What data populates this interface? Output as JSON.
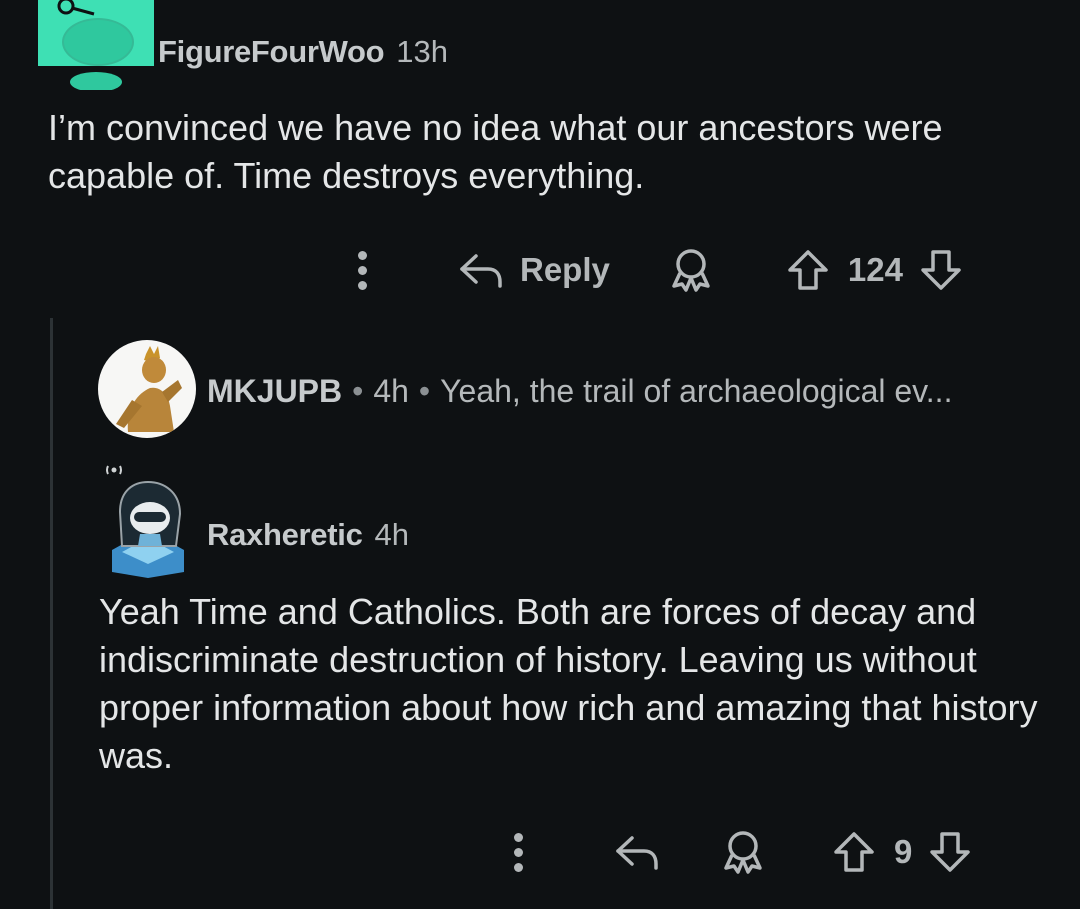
{
  "top_comment": {
    "author": "FigureFourWoo",
    "time": "13h",
    "body": "I’m convinced we have no idea what our ancestors were capable of. Time destroys everything.",
    "reply_label": "Reply",
    "votes": "124"
  },
  "collapsed_reply": {
    "author": "MKJUPB",
    "separator": "•",
    "time": "4h",
    "preview": "Yeah, the trail of archaeological ev..."
  },
  "reply": {
    "author": "Raxheretic",
    "time": "4h",
    "body": "Yeah Time and Catholics. Both are forces of decay and indiscriminate destruction of history. Leaving us without proper information about how rich and amazing that history was.",
    "votes": "9"
  },
  "colors": {
    "background": "#0e1113",
    "avatar_top": "#3ee0b4",
    "text": "#e4e6e7",
    "muted": "#b3b7b9"
  },
  "icons": [
    "more-vertical-icon",
    "reply-arrow-icon",
    "award-icon",
    "upvote-icon",
    "downvote-icon",
    "reddit-snoo-icon",
    "wifi-signal-icon"
  ]
}
